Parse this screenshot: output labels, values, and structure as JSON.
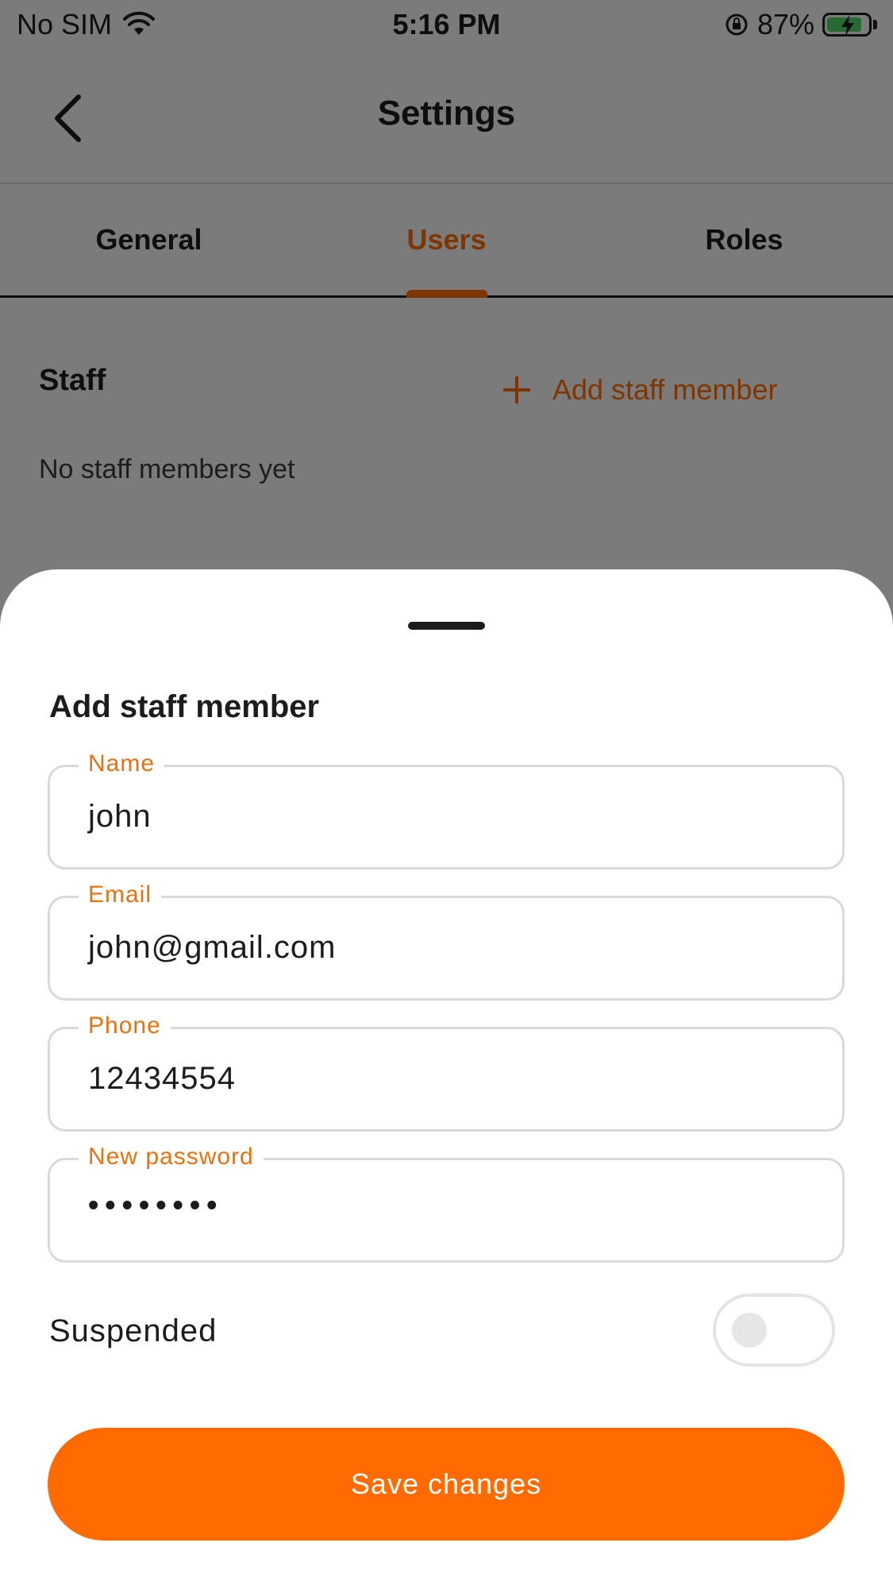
{
  "status_bar": {
    "carrier": "No SIM",
    "time": "5:16 PM",
    "battery": "87%"
  },
  "header": {
    "title": "Settings"
  },
  "tabs": [
    {
      "label": "General",
      "active": false
    },
    {
      "label": "Users",
      "active": true
    },
    {
      "label": "Roles",
      "active": false
    }
  ],
  "staff": {
    "heading": "Staff",
    "add_label": "Add staff member",
    "empty_text": "No staff members yet"
  },
  "sheet": {
    "title": "Add staff member",
    "fields": {
      "name": {
        "label": "Name",
        "value": "john"
      },
      "email": {
        "label": "Email",
        "value": "john@gmail.com"
      },
      "phone": {
        "label": "Phone",
        "value": "12434554"
      },
      "password": {
        "label": "New password",
        "value": "••••••••"
      }
    },
    "suspended_label": "Suspended",
    "suspended_on": false,
    "save_label": "Save changes"
  },
  "colors": {
    "accent": "#ff6b00",
    "label_accent": "#e8700d",
    "battery_fill": "#4cd964"
  }
}
